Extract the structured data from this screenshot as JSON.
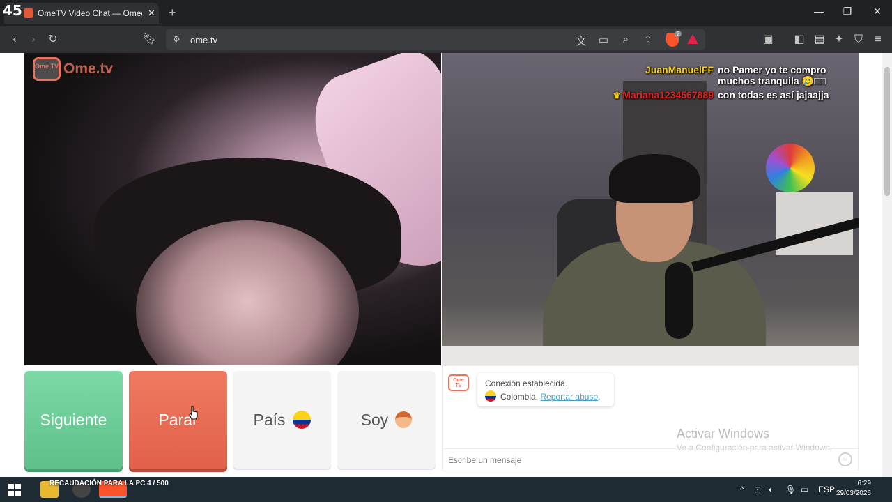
{
  "browser": {
    "overlay_count": "45",
    "tab_title": "OmeTV Video Chat — Omegle",
    "tab_close": "✕",
    "new_tab": "+",
    "url": "ome.tv",
    "brave_shield_count": "2",
    "window_controls": {
      "minimize": "—",
      "maximize": "❐",
      "close": "✕"
    }
  },
  "site": {
    "logo_tv": "Ome TV",
    "logo_text": "Ome.tv",
    "buttons": {
      "next": "Siguiente",
      "stop": "Parar",
      "country": "País",
      "gender": "Soy"
    },
    "chat": {
      "logo": "Ome TV",
      "status": "Conexión establecida.",
      "country": "Colombia.",
      "report": "Reportar abuso",
      "report_suffix": ".",
      "input_placeholder": "Escribe un mensaje",
      "smiley": "☺"
    },
    "watermark": {
      "title": "Activar Windows",
      "subtitle": "Ve a Configuración para activar Windows."
    }
  },
  "stream_chat": [
    {
      "user": "JuanManuelFF",
      "message": "no Pamer yo te compro muchos tranquila 🥲□□",
      "color": "#f5d020",
      "crown": ""
    },
    {
      "user": "Mariana1234567889",
      "message": "con todas es así jajaajja",
      "color": "#e0241f",
      "crown": "♛"
    }
  ],
  "taskbar": {
    "fundraising": "RECAUDACIÓN PARA LA PC 4 / 500",
    "language": "ESP",
    "time": "6:29",
    "date": "29/03/2026"
  },
  "colors": {
    "next_green": "#6fcf97",
    "stop_red": "#eb6e55",
    "brand_orange": "#e9735d",
    "link_blue": "#4a9fc1"
  }
}
